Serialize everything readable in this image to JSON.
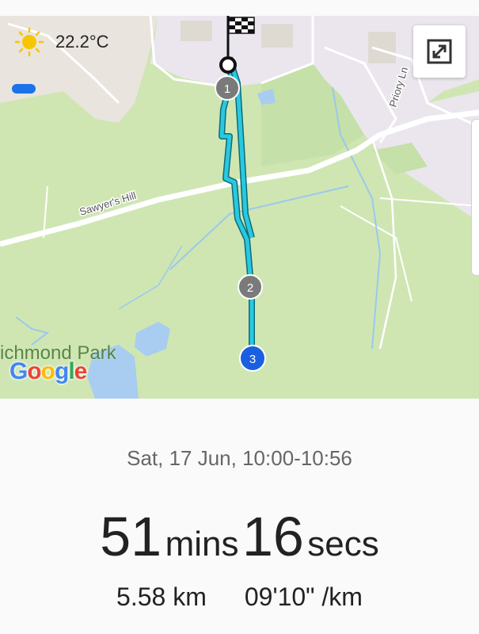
{
  "weather": {
    "temperature": "22.2°C",
    "icon": "sun-icon"
  },
  "map": {
    "labels": {
      "road_1": "Sawyer's Hill",
      "road_2": "Priory Ln",
      "park": "ichmond Park"
    },
    "attribution": "Google",
    "markers": [
      "1",
      "2",
      "3"
    ],
    "finish_icon": "checkered-flag-icon",
    "expand_icon": "expand-icon",
    "route_color": "#29c9e0",
    "end_marker_color": "#1a5fe0",
    "split_marker_color": "#7a7a7a"
  },
  "workout": {
    "date_time": "Sat, 17 Jun, 10:00-10:56",
    "duration": {
      "minutes": "51",
      "minutes_unit": "mins",
      "seconds": "16",
      "seconds_unit": "secs"
    },
    "distance": "5.58 km",
    "pace": "09'10\" /km"
  }
}
